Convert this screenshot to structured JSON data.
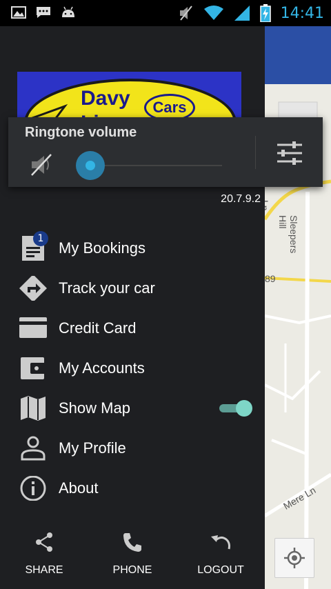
{
  "status_bar": {
    "time": "14:41",
    "left_icons": [
      "image-icon",
      "chat-icon",
      "android-icon"
    ],
    "right_icons": [
      "muted-speaker-icon",
      "wifi-icon",
      "signal-icon",
      "battery-charging-icon"
    ],
    "time_color": "#33b5e5"
  },
  "drawer": {
    "logo": {
      "line1": "Davy",
      "line2": "Liver",
      "badge": "Cars"
    },
    "version": "20.7.9.2",
    "menu": [
      {
        "label": "My Bookings",
        "icon": "bookings-icon",
        "badge": "1"
      },
      {
        "label": "Track your car",
        "icon": "directions-icon"
      },
      {
        "label": "Credit Card",
        "icon": "credit-card-icon"
      },
      {
        "label": "My Accounts",
        "icon": "wallet-icon"
      },
      {
        "label": "Show Map",
        "icon": "map-icon",
        "toggle_on": true
      },
      {
        "label": "My Profile",
        "icon": "person-icon"
      },
      {
        "label": "About",
        "icon": "info-icon"
      }
    ],
    "bottom": [
      {
        "label": "SHARE",
        "icon": "share-icon"
      },
      {
        "label": "PHONE",
        "icon": "phone-icon"
      },
      {
        "label": "LOGOUT",
        "icon": "undo-icon"
      }
    ]
  },
  "map": {
    "labels": [
      "Sleepers Hill",
      "89",
      "Mere Ln",
      "Ln"
    ]
  },
  "volume_dialog": {
    "title": "Ringtone volume",
    "level": 0,
    "accent": "#33b5e5"
  }
}
